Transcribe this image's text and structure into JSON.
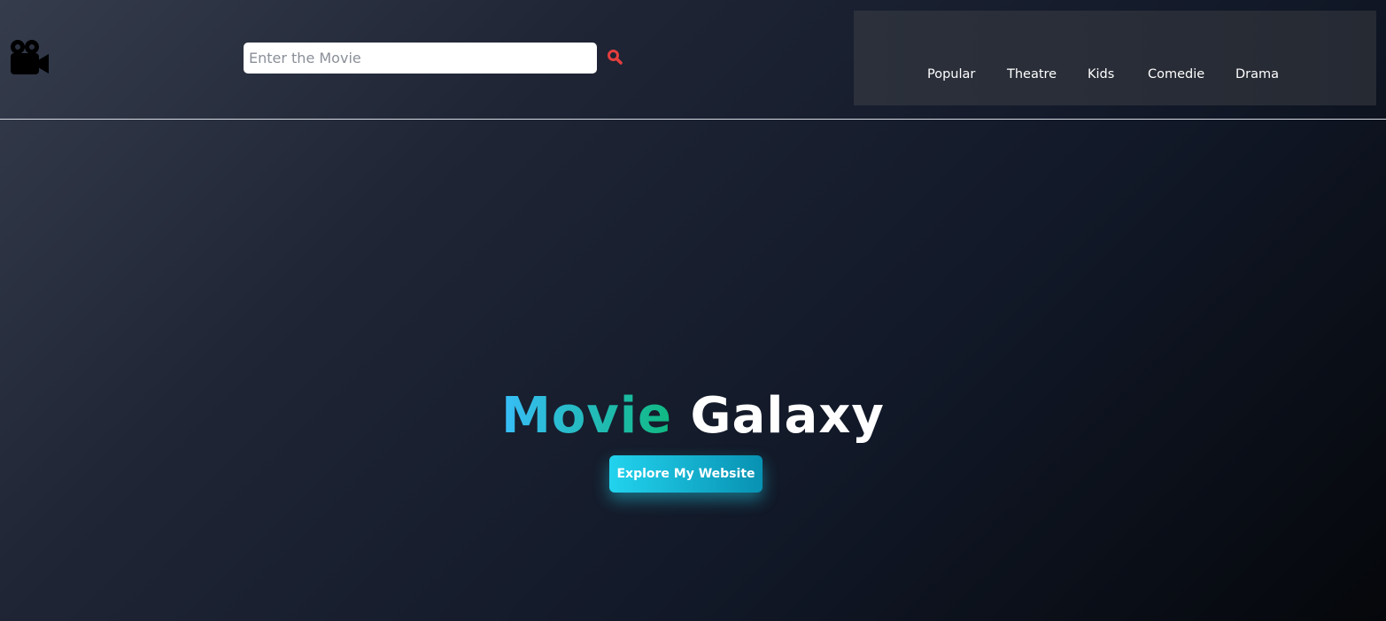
{
  "header": {
    "logo_icon": "movie-camera-icon",
    "search": {
      "placeholder": "Enter the Movie",
      "value": "",
      "button_icon": "search-icon",
      "button_color": "#e53e3e"
    },
    "nav": {
      "items": [
        {
          "label": "Popular"
        },
        {
          "label": "Theatre"
        },
        {
          "label": "Kids"
        },
        {
          "label": "Comedie"
        },
        {
          "label": "Drama"
        }
      ]
    }
  },
  "hero": {
    "title_part1": "Movie",
    "title_part2": "Galaxy",
    "cta_label": "Explore My Website",
    "accent_colors": {
      "gradient_start": "#38bdf8",
      "gradient_end": "#10b981",
      "button_start": "#22d3ee",
      "button_end": "#0891b2"
    }
  }
}
